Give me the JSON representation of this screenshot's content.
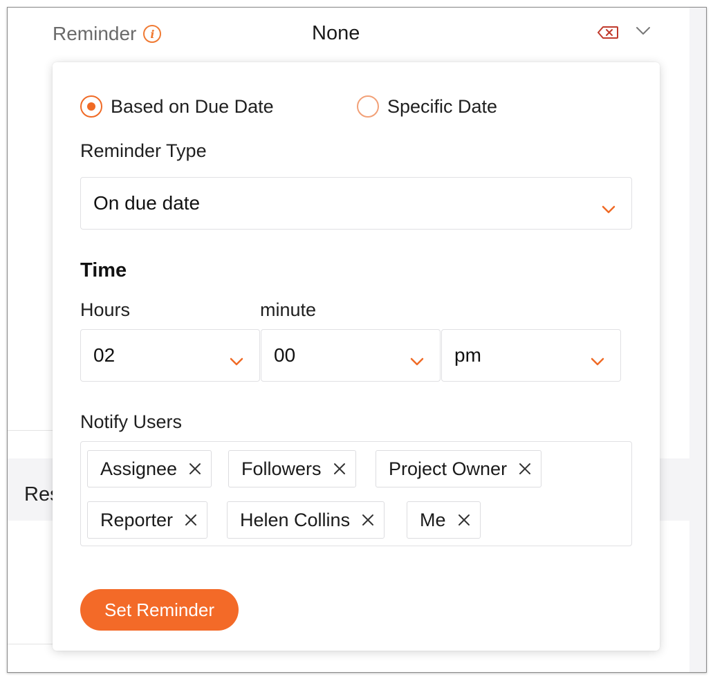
{
  "header": {
    "label": "Reminder",
    "value": "None"
  },
  "background": {
    "partial_text": "Res"
  },
  "popup": {
    "radio_options": [
      {
        "label": "Based on Due Date",
        "checked": true
      },
      {
        "label": "Specific Date",
        "checked": false
      }
    ],
    "reminder_type": {
      "label": "Reminder Type",
      "value": "On due date"
    },
    "time": {
      "title": "Time",
      "hours_label": "Hours",
      "minute_label": "minute",
      "hours_value": "02",
      "minute_value": "00",
      "ampm_value": "pm"
    },
    "notify_users": {
      "label": "Notify Users",
      "chips": [
        "Assignee",
        "Followers",
        "Project Owner",
        "Reporter",
        "Helen Collins",
        "Me"
      ]
    },
    "submit_label": "Set Reminder"
  },
  "icons": {
    "info": "info-icon",
    "clear": "clear-backspace-icon",
    "chevron": "chevron-down-icon",
    "remove": "close-icon"
  },
  "colors": {
    "accent": "#f36a28",
    "radio_border": "#f2a077",
    "clear_icon": "#c0392b",
    "label_gray": "#6a6a6a"
  }
}
